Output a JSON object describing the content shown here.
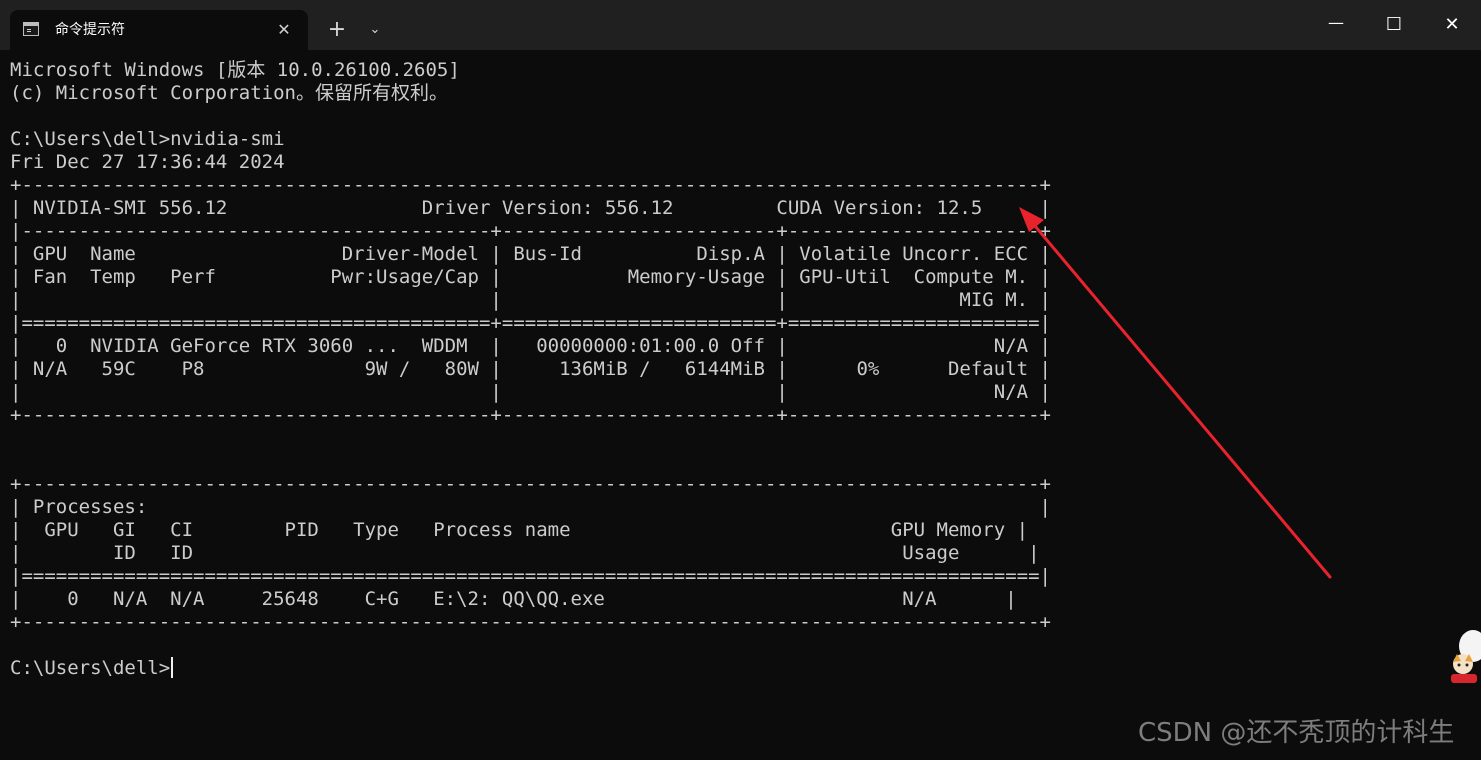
{
  "window": {
    "tab_title": "命令提示符",
    "tab_close": "✕",
    "new_tab": "+",
    "dropdown": "⌄",
    "minimize": "—",
    "maximize": "☐",
    "close": "✕"
  },
  "console": {
    "lines": [
      "Microsoft Windows [版本 10.0.26100.2605]",
      "(c) Microsoft Corporation。保留所有权利。",
      "",
      "C:\\Users\\dell>nvidia-smi",
      "Fri Dec 27 17:36:44 2024",
      "+-----------------------------------------------------------------------------------------+",
      "| NVIDIA-SMI 556.12                 Driver Version: 556.12         CUDA Version: 12.5     |",
      "|-----------------------------------------+------------------------+----------------------+",
      "| GPU  Name                  Driver-Model | Bus-Id          Disp.A | Volatile Uncorr. ECC |",
      "| Fan  Temp   Perf          Pwr:Usage/Cap |           Memory-Usage | GPU-Util  Compute M. |",
      "|                                         |                        |               MIG M. |",
      "|=========================================+========================+======================|",
      "|   0  NVIDIA GeForce RTX 3060 ...  WDDM  |   00000000:01:00.0 Off |                  N/A |",
      "| N/A   59C    P8              9W /   80W |     136MiB /   6144MiB |      0%      Default |",
      "|                                         |                        |                  N/A |",
      "+-----------------------------------------+------------------------+----------------------+",
      "",
      "",
      "+-----------------------------------------------------------------------------------------+",
      "| Processes:                                                                              |",
      "|  GPU   GI   CI        PID   Type   Process name                            GPU Memory |",
      "|        ID   ID                                                              Usage      |",
      "|=========================================================================================|",
      "|    0   N/A  N/A     25648    C+G   E:\\2: QQ\\QQ.exe                          N/A      |",
      "+-----------------------------------------------------------------------------------------+",
      "",
      "C:\\Users\\dell>"
    ]
  },
  "watermark": "CSDN @还不秃顶的计科生",
  "colors": {
    "background": "#0c0c0c",
    "titlebar": "#202020",
    "text": "#cccccc",
    "arrow": "#e8232e"
  }
}
